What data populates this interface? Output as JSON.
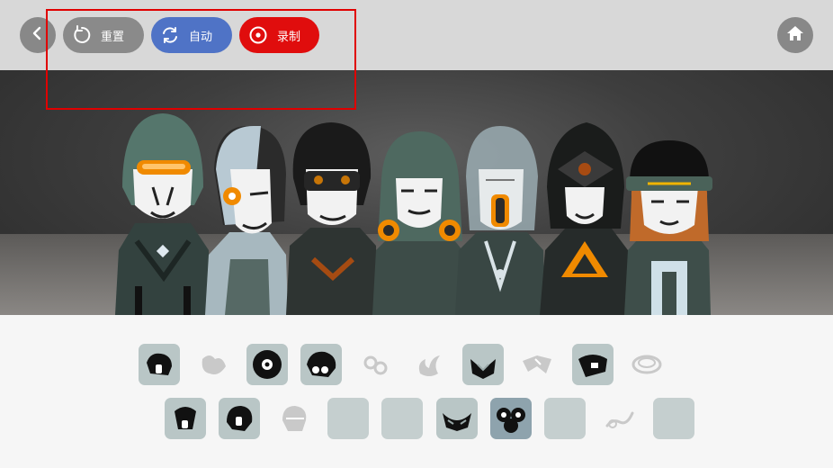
{
  "toolbar": {
    "back_icon": "chevron-left-icon",
    "reset_label": "重置",
    "reset_icon": "rotate-icon",
    "auto_label": "自动",
    "auto_icon": "refresh-icon",
    "record_label": "录制",
    "record_icon": "record-icon",
    "home_icon": "home-icon"
  },
  "colors": {
    "topbar_bg": "#d8d8d8",
    "round_button": "#888888",
    "reset_pill": "#8a8a8a",
    "auto_pill": "#4f73c6",
    "record_pill": "#e00d0d",
    "highlight": "#e00000",
    "tray_bg": "#f6f6f6",
    "slot": "#b9c6c6"
  },
  "stage": {
    "characters": [
      {
        "name": "visor-singer",
        "accent": "orange-visor"
      },
      {
        "name": "cyborg-singer",
        "accent": "orange-eye"
      },
      {
        "name": "sunglasses-singer",
        "accent": "dark-glasses"
      },
      {
        "name": "hooded-singer",
        "accent": "orange-mask"
      },
      {
        "name": "glass-helmet-singer",
        "accent": "orange-pipe"
      },
      {
        "name": "pyramid-singer",
        "accent": "orange-eye"
      },
      {
        "name": "captain-singer",
        "accent": "hat-stripe"
      }
    ]
  },
  "tray": {
    "row1": [
      {
        "name": "sound-slot-1",
        "state": "filled"
      },
      {
        "name": "sound-slot-2",
        "state": "ghost"
      },
      {
        "name": "sound-slot-3",
        "state": "filled"
      },
      {
        "name": "sound-slot-4",
        "state": "filled"
      },
      {
        "name": "sound-slot-5",
        "state": "ghost"
      },
      {
        "name": "sound-slot-6",
        "state": "ghost"
      },
      {
        "name": "sound-slot-7",
        "state": "filled"
      },
      {
        "name": "sound-slot-8",
        "state": "ghost"
      },
      {
        "name": "sound-slot-9",
        "state": "filled"
      },
      {
        "name": "sound-slot-10",
        "state": "ghost"
      }
    ],
    "row2": [
      {
        "name": "sound-slot-11",
        "state": "filled"
      },
      {
        "name": "sound-slot-12",
        "state": "filled"
      },
      {
        "name": "sound-slot-13",
        "state": "ghost"
      },
      {
        "name": "sound-slot-14",
        "state": "empty"
      },
      {
        "name": "sound-slot-15",
        "state": "empty"
      },
      {
        "name": "sound-slot-16",
        "state": "filled"
      },
      {
        "name": "sound-slot-17",
        "state": "active"
      },
      {
        "name": "sound-slot-18",
        "state": "empty"
      },
      {
        "name": "sound-slot-19",
        "state": "ghost"
      },
      {
        "name": "sound-slot-20",
        "state": "empty"
      }
    ]
  }
}
